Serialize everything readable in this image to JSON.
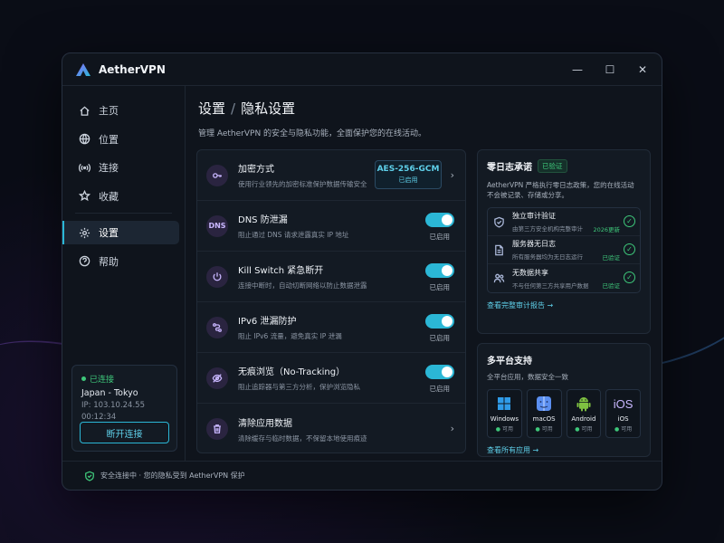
{
  "app": {
    "title": "AetherVPN"
  },
  "window_controls": {
    "minimize": "—",
    "maximize": "☐",
    "close": "✕"
  },
  "sidebar": {
    "items": [
      {
        "label": "主页",
        "icon": "home-icon"
      },
      {
        "label": "位置",
        "icon": "globe-icon"
      },
      {
        "label": "连接",
        "icon": "signal-icon"
      },
      {
        "label": "收藏",
        "icon": "star-icon"
      },
      {
        "label": "设置",
        "icon": "gear-icon",
        "active": true
      },
      {
        "label": "帮助",
        "icon": "help-icon"
      }
    ]
  },
  "connection": {
    "status": "已连接",
    "location": "Japan - Tokyo",
    "ip": "IP: 103.10.24.55",
    "duration": "00:12:34",
    "disconnect_label": "断开连接"
  },
  "header": {
    "title": "设置",
    "separator": "/",
    "subtitle": "隐私设置",
    "description": "管理 AetherVPN 的安全与隐私功能，全面保护您的在线活动。"
  },
  "settings": {
    "encryption": {
      "title": "加密方式",
      "desc": "使用行业领先的加密标准保护数据传输安全",
      "value": "AES-256-GCM",
      "status": "已启用"
    },
    "dns": {
      "icon_text": "DNS",
      "title": "DNS 防泄漏",
      "desc": "阻止通过 DNS 请求泄露真实 IP 地址",
      "status": "已启用"
    },
    "kill_switch": {
      "title": "Kill Switch 紧急断开",
      "desc": "连接中断时，自动切断网络以防止数据泄露",
      "status": "已启用"
    },
    "ipv6": {
      "title": "IPv6 泄漏防护",
      "desc": "阻止 IPv6 流量，避免真实 IP 泄漏",
      "status": "已启用"
    },
    "no_tracking": {
      "title": "无痕浏览（No-Tracking）",
      "desc": "阻止追踪器与第三方分析，保护浏览隐私",
      "status": "已启用"
    },
    "clear_data": {
      "title": "清除应用数据",
      "desc": "清除缓存与临时数据，不保留本地使用痕迹"
    }
  },
  "no_log": {
    "title": "零日志承诺",
    "badge": "已验证",
    "desc": "AetherVPN 严格执行零日志政策，您的在线活动不会被记录、存储或分享。",
    "items": [
      {
        "title": "独立审计验证",
        "sub": "由第三方安全机构完整审计",
        "tag": "2026更新"
      },
      {
        "title": "服务器无日志",
        "sub": "所有服务器均为无日志运行",
        "tag": "已验证"
      },
      {
        "title": "无数据共享",
        "sub": "不与任何第三方共享用户数据",
        "tag": "已验证"
      }
    ],
    "link": "查看完整审计报告 →"
  },
  "platforms": {
    "title": "多平台支持",
    "desc": "全平台应用，数据安全一致",
    "items": [
      {
        "name": "Windows",
        "status": "可用"
      },
      {
        "name": "macOS",
        "status": "可用"
      },
      {
        "name": "Android",
        "status": "可用"
      },
      {
        "name": "iOS",
        "status": "可用",
        "icon_text": "iOS"
      }
    ],
    "link": "查看所有应用 →"
  },
  "statusbar": {
    "text": "安全连接中 · 您的隐私受到 AetherVPN 保护"
  },
  "colors": {
    "accent": "#2bb7d6",
    "success": "#3ec77a",
    "icon_bg": "#2a2440"
  }
}
